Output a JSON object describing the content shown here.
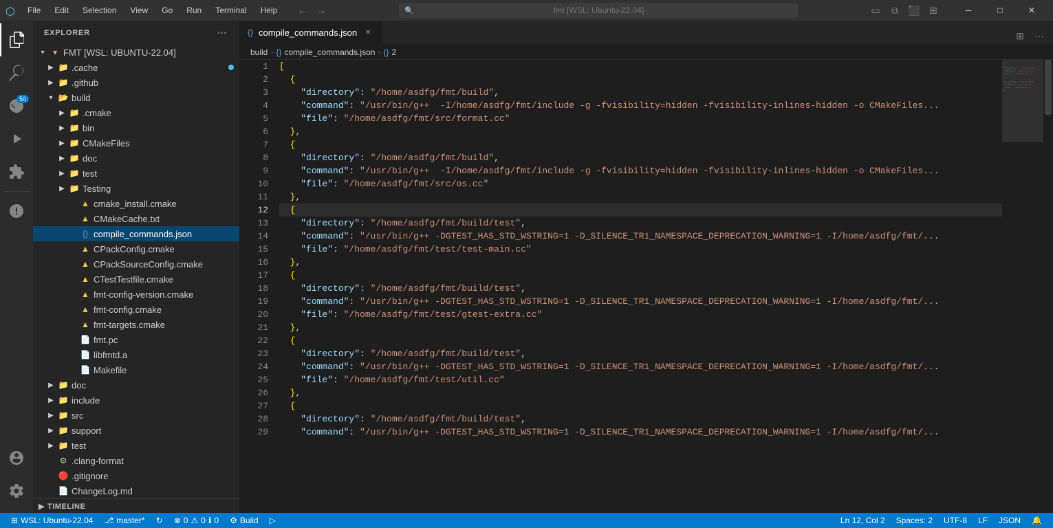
{
  "titlebar": {
    "icon": "⬡",
    "menus": [
      "File",
      "Edit",
      "Selection",
      "View",
      "Go",
      "Run",
      "Terminal",
      "Help"
    ],
    "nav_back": "←",
    "nav_forward": "→",
    "search_placeholder": "fmt [WSL: Ubuntu-22.04]",
    "window_buttons": [
      "─",
      "□",
      "✕"
    ]
  },
  "activity_bar": {
    "items": [
      {
        "icon": "⎘",
        "name": "explorer",
        "label": "Explorer",
        "active": true
      },
      {
        "icon": "⌕",
        "name": "search",
        "label": "Search"
      },
      {
        "icon": "⎇",
        "name": "source-control",
        "label": "Source Control",
        "badge": "50"
      },
      {
        "icon": "▷",
        "name": "run-debug",
        "label": "Run and Debug"
      },
      {
        "icon": "⧉",
        "name": "extensions",
        "label": "Extensions"
      },
      {
        "icon": "⚠",
        "name": "problems",
        "label": "Problems"
      }
    ],
    "bottom": [
      {
        "icon": "⚙",
        "name": "settings",
        "label": "Settings"
      },
      {
        "icon": "👤",
        "name": "account",
        "label": "Account"
      }
    ]
  },
  "sidebar": {
    "title": "EXPLORER",
    "root": "FMT [WSL: UBUNTU-22.04]",
    "tree": [
      {
        "id": "cache",
        "label": ".cache",
        "type": "folder",
        "indent": 1,
        "expanded": false,
        "modified": true
      },
      {
        "id": "github",
        "label": ".github",
        "type": "folder",
        "indent": 1,
        "expanded": false
      },
      {
        "id": "build",
        "label": "build",
        "type": "folder-open",
        "indent": 1,
        "expanded": true
      },
      {
        "id": "cmake",
        "label": ".cmake",
        "type": "folder",
        "indent": 2,
        "expanded": false
      },
      {
        "id": "bin",
        "label": "bin",
        "type": "folder",
        "indent": 2,
        "expanded": false
      },
      {
        "id": "cmakefiles",
        "label": "CMakeFiles",
        "type": "folder",
        "indent": 2,
        "expanded": false
      },
      {
        "id": "doc-build",
        "label": "doc",
        "type": "folder",
        "indent": 2,
        "expanded": false
      },
      {
        "id": "test-build",
        "label": "test",
        "type": "folder",
        "indent": 2,
        "expanded": false
      },
      {
        "id": "testing",
        "label": "Testing",
        "type": "folder",
        "indent": 2,
        "expanded": false
      },
      {
        "id": "cmake-install",
        "label": "cmake_install.cmake",
        "type": "cmake",
        "indent": 3
      },
      {
        "id": "cmakecache",
        "label": "CMakeCache.txt",
        "type": "cmake-yellow",
        "indent": 3
      },
      {
        "id": "compile-commands",
        "label": "compile_commands.json",
        "type": "json",
        "indent": 3,
        "selected": true
      },
      {
        "id": "cpackconfig",
        "label": "CPackConfig.cmake",
        "type": "cmake-yellow",
        "indent": 3
      },
      {
        "id": "cpacksource",
        "label": "CPackSourceConfig.cmake",
        "type": "cmake-yellow",
        "indent": 3
      },
      {
        "id": "ctestfile",
        "label": "CTestTestfile.cmake",
        "type": "cmake-yellow",
        "indent": 3
      },
      {
        "id": "fmt-config-version",
        "label": "fmt-config-version.cmake",
        "type": "cmake-yellow",
        "indent": 3
      },
      {
        "id": "fmt-config",
        "label": "fmt-config.cmake",
        "type": "cmake-yellow",
        "indent": 3
      },
      {
        "id": "fmt-targets",
        "label": "fmt-targets.cmake",
        "type": "cmake-yellow",
        "indent": 3
      },
      {
        "id": "fmtpc",
        "label": "fmt.pc",
        "type": "pc",
        "indent": 3
      },
      {
        "id": "libfmtd",
        "label": "libfmtd.a",
        "type": "lib",
        "indent": 3
      },
      {
        "id": "makefile",
        "label": "Makefile",
        "type": "make",
        "indent": 3
      },
      {
        "id": "doc",
        "label": "doc",
        "type": "folder",
        "indent": 1,
        "expanded": false
      },
      {
        "id": "include",
        "label": "include",
        "type": "folder",
        "indent": 1,
        "expanded": false
      },
      {
        "id": "src",
        "label": "src",
        "type": "folder",
        "indent": 1,
        "expanded": false
      },
      {
        "id": "support",
        "label": "support",
        "type": "folder",
        "indent": 1,
        "expanded": false
      },
      {
        "id": "test",
        "label": "test",
        "type": "folder",
        "indent": 1,
        "expanded": false
      },
      {
        "id": "clang-format",
        "label": ".clang-format",
        "type": "clang",
        "indent": 1
      },
      {
        "id": "gitignore",
        "label": ".gitignore",
        "type": "git",
        "indent": 1
      },
      {
        "id": "changelog",
        "label": "ChangeLog.md",
        "type": "md",
        "indent": 1
      }
    ],
    "timeline": "TIMELINE"
  },
  "tab_bar": {
    "tabs": [
      {
        "id": "compile-commands-tab",
        "icon": "{}",
        "label": "compile_commands.json",
        "active": true,
        "closable": true
      }
    ]
  },
  "breadcrumb": {
    "parts": [
      "build",
      "> {} compile_commands.json",
      "> {} 2"
    ]
  },
  "editor": {
    "filename": "compile_commands.json",
    "lines": [
      {
        "n": 1,
        "content": "["
      },
      {
        "n": 2,
        "content": "  {"
      },
      {
        "n": 3,
        "content": "    \"directory\": \"/home/asdfg/fmt/build\","
      },
      {
        "n": 4,
        "content": "    \"command\": \"/usr/bin/g++  -I/home/asdfg/fmt/include -g -fvisibility=hidden -fvisibility-inlines-hidden -o CMakeFiles..."
      },
      {
        "n": 5,
        "content": "    \"file\": \"/home/asdfg/fmt/src/format.cc\""
      },
      {
        "n": 6,
        "content": "  },"
      },
      {
        "n": 7,
        "content": "  {"
      },
      {
        "n": 8,
        "content": "    \"directory\": \"/home/asdfg/fmt/build\","
      },
      {
        "n": 9,
        "content": "    \"command\": \"/usr/bin/g++  -I/home/asdfg/fmt/include -g -fvisibility=hidden -fvisibility-inlines-hidden -o CMakeFiles..."
      },
      {
        "n": 10,
        "content": "    \"file\": \"/home/asdfg/fmt/src/os.cc\""
      },
      {
        "n": 11,
        "content": "  },"
      },
      {
        "n": 12,
        "content": "  {"
      },
      {
        "n": 13,
        "content": "    \"directory\": \"/home/asdfg/fmt/build/test\","
      },
      {
        "n": 14,
        "content": "    \"command\": \"/usr/bin/g++ -DGTEST_HAS_STD_WSTRING=1 -D_SILENCE_TR1_NAMESPACE_DEPRECATION_WARNING=1 -I/home/asdfg/fmt/..."
      },
      {
        "n": 15,
        "content": "    \"file\": \"/home/asdfg/fmt/test/test-main.cc\""
      },
      {
        "n": 16,
        "content": "  },"
      },
      {
        "n": 17,
        "content": "  {"
      },
      {
        "n": 18,
        "content": "    \"directory\": \"/home/asdfg/fmt/build/test\","
      },
      {
        "n": 19,
        "content": "    \"command\": \"/usr/bin/g++ -DGTEST_HAS_STD_WSTRING=1 -D_SILENCE_TR1_NAMESPACE_DEPRECATION_WARNING=1 -I/home/asdfg/fmt/..."
      },
      {
        "n": 20,
        "content": "    \"file\": \"/home/asdfg/fmt/test/gtest-extra.cc\""
      },
      {
        "n": 21,
        "content": "  },"
      },
      {
        "n": 22,
        "content": "  {"
      },
      {
        "n": 23,
        "content": "    \"directory\": \"/home/asdfg/fmt/build/test\","
      },
      {
        "n": 24,
        "content": "    \"command\": \"/usr/bin/g++ -DGTEST_HAS_STD_WSTRING=1 -D_SILENCE_TR1_NAMESPACE_DEPRECATION_WARNING=1 -I/home/asdfg/fmt/..."
      },
      {
        "n": 25,
        "content": "    \"file\": \"/home/asdfg/fmt/test/util.cc\""
      },
      {
        "n": 26,
        "content": "  },"
      },
      {
        "n": 27,
        "content": "  {"
      },
      {
        "n": 28,
        "content": "    \"directory\": \"/home/asdfg/fmt/build/test\","
      },
      {
        "n": 29,
        "content": "    \"command\": \"/usr/bin/g++ -DGTEST_HAS_STD_WSTRING=1 -D_SILENCE_TR1_NAMESPACE_DEPRECATION_WARNING=1 -I/home/asdfg/fmt/..."
      }
    ]
  },
  "status_bar": {
    "left": [
      {
        "id": "remote",
        "icon": "⊞",
        "text": "WSL: Ubuntu-22.04"
      },
      {
        "id": "branch",
        "icon": "⎇",
        "text": "master*"
      },
      {
        "id": "sync",
        "icon": "↻",
        "text": ""
      },
      {
        "id": "errors",
        "icon": "⊗",
        "text": "0"
      },
      {
        "id": "warnings",
        "icon": "⚠",
        "text": "0"
      },
      {
        "id": "info",
        "icon": "ℹ",
        "text": "0"
      },
      {
        "id": "build",
        "icon": "⚙",
        "text": "Build"
      },
      {
        "id": "run",
        "icon": "▷",
        "text": ""
      }
    ],
    "right": [
      {
        "id": "position",
        "text": "Ln 12, Col 2"
      },
      {
        "id": "spaces",
        "text": "Spaces: 2"
      },
      {
        "id": "encoding",
        "text": "UTF-8"
      },
      {
        "id": "eol",
        "text": "LF"
      },
      {
        "id": "lang",
        "text": "JSON"
      },
      {
        "id": "notifications",
        "icon": "🔔",
        "text": ""
      }
    ]
  }
}
